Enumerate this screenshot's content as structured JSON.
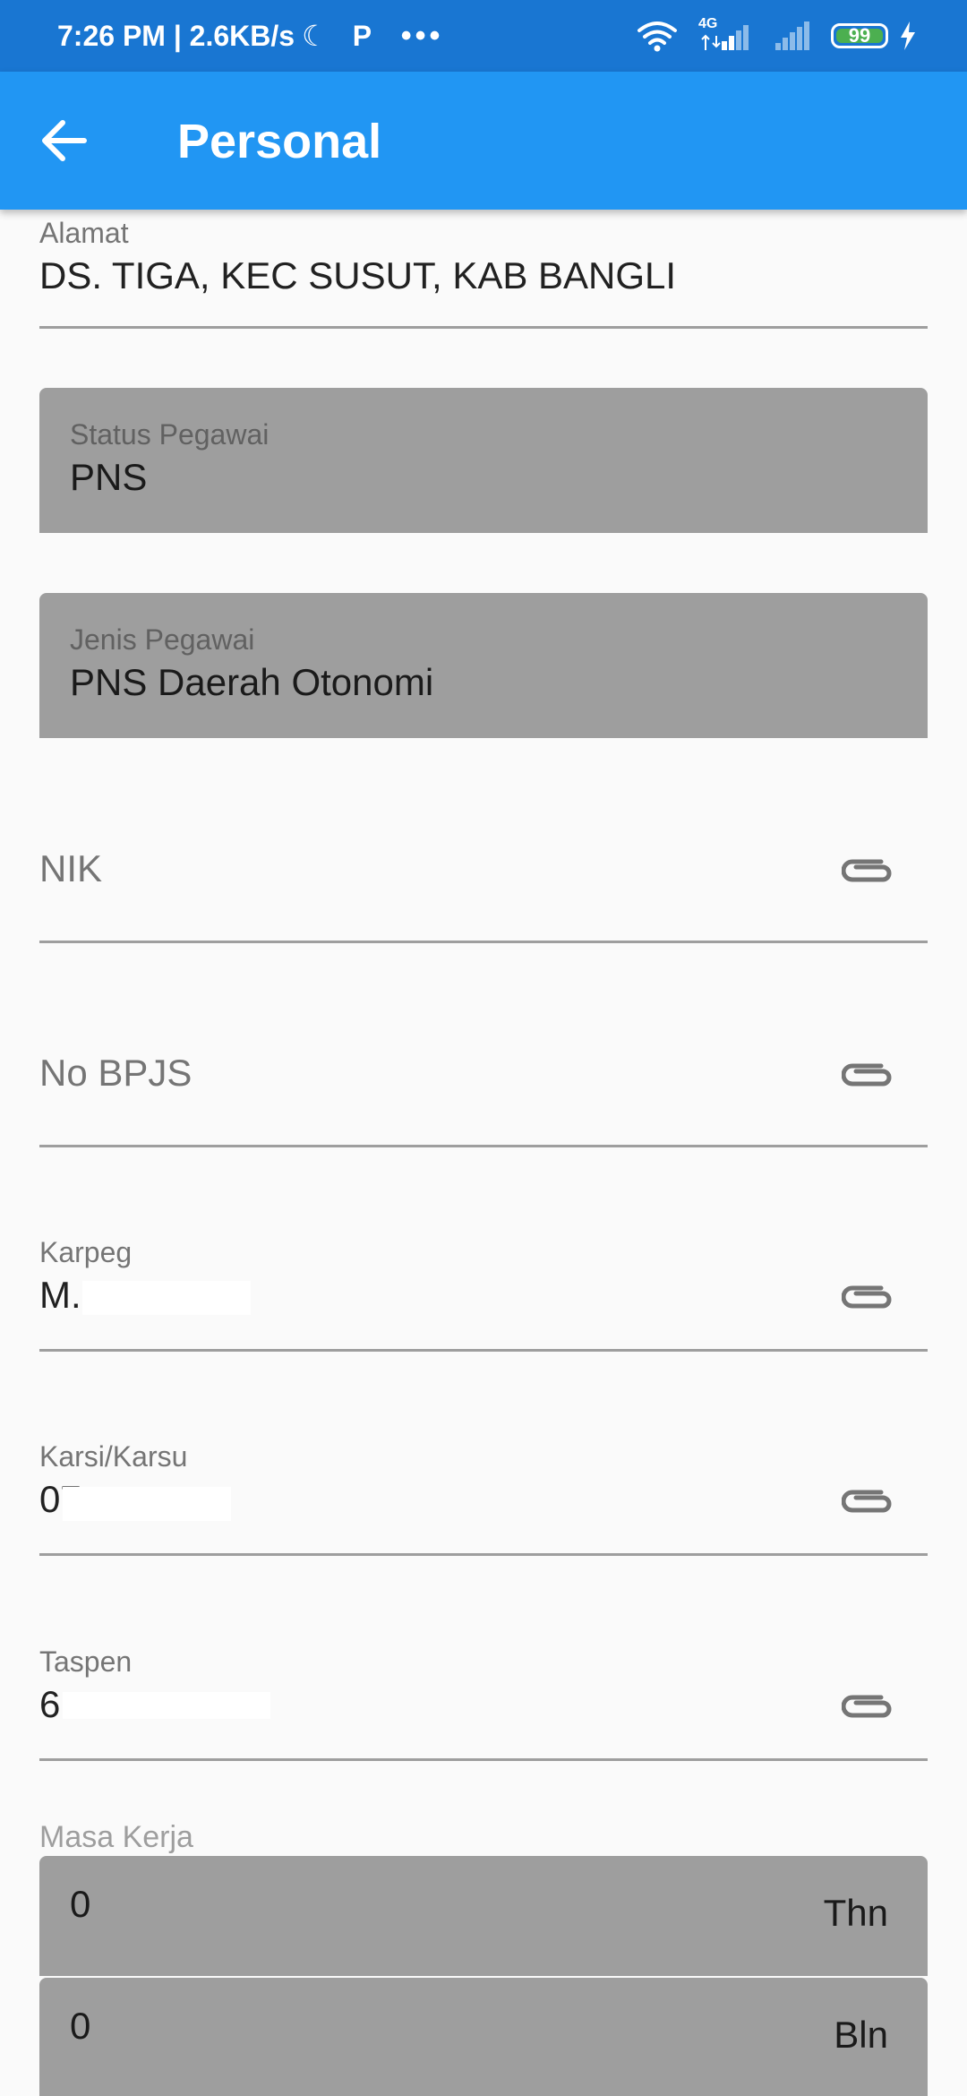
{
  "status_bar": {
    "time": "7:26 PM",
    "speed": "2.6KB/s",
    "network_label": "4G",
    "battery": "99",
    "icons": [
      "moon-icon",
      "parking-app-icon",
      "more-dots-icon",
      "wifi-icon",
      "signal-icon",
      "battery-icon",
      "charging-icon"
    ]
  },
  "app_bar": {
    "title": "Personal",
    "back_icon": "arrow-back-icon"
  },
  "fields": {
    "alamat": {
      "label": "Alamat",
      "value": "DS. TIGA, KEC SUSUT, KAB BANGLI"
    },
    "status_pegawai": {
      "label": "Status Pegawai",
      "value": "PNS"
    },
    "jenis_pegawai": {
      "label": "Jenis Pegawai",
      "value": "PNS Daerah Otonomi"
    },
    "nik": {
      "placeholder": "NIK"
    },
    "no_bpjs": {
      "placeholder": "No BPJS"
    },
    "karpeg": {
      "label": "Karpeg",
      "value": "M."
    },
    "karsi": {
      "label": "Karsi/Karsu",
      "value": "07"
    },
    "taspen": {
      "label": "Taspen",
      "value": "6"
    }
  },
  "masa_kerja": {
    "label": "Masa Kerja",
    "tahun": {
      "value": "0",
      "suffix": "Thn"
    },
    "bulan": {
      "value": "0",
      "suffix": "Bln"
    }
  },
  "colors": {
    "status_bar": "#1976d2",
    "app_bar": "#2196f3",
    "filled_field": "#9e9e9e",
    "background": "#fafafa"
  }
}
